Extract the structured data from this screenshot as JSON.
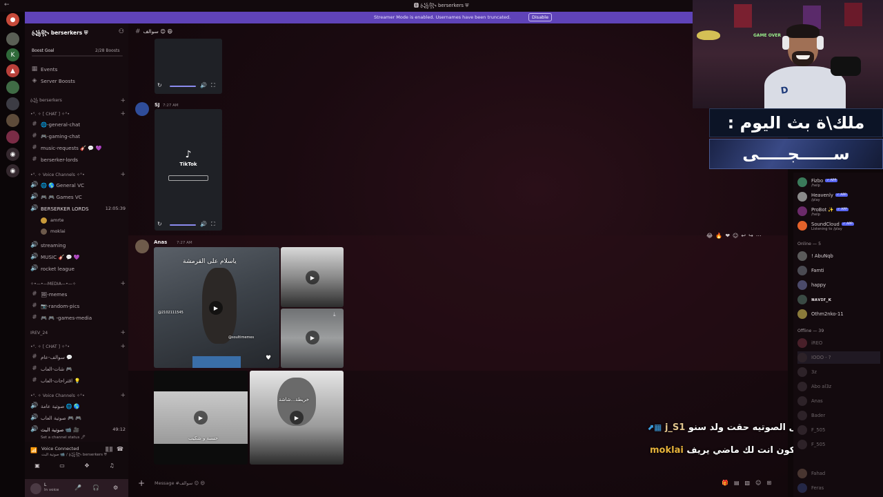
{
  "window": {
    "title": "🅱 ꧁ꦿ꧂ berserkers ⛨",
    "back_glyph": "←"
  },
  "banner": {
    "message": "Streamer Mode is enabled. Usernames have been truncated.",
    "disable_label": "Disable"
  },
  "server": {
    "name": "꧁ꦿ꧂ berserkers ⛨",
    "boost_goal_label": "Boost Goal",
    "boost_count": "2/28 Boosts"
  },
  "sidebar": {
    "top_items": [
      "Events",
      "Server Boosts"
    ],
    "category_berserkers": "꧁ꦿ berserkers",
    "text_channels_1": [
      "🌐-general-chat",
      "🎮-gaming-chat",
      "music-requests 🎸 💬 💜",
      "berserker-lords"
    ],
    "voice_category_1": "•°. ✧ Voice Channels ✧°•",
    "voice_channels_1": [
      "🌐 🌎 General VC",
      "🎮 🎮 Games VC",
      "BERSERKER LORDS"
    ],
    "berserker_lords_time": "12:05:39",
    "voice_users": [
      "amrte",
      "moklai"
    ],
    "voice_channels_2": [
      "streaming",
      "MUSIC 🎸 💬 💜",
      "rocket league"
    ],
    "media_category": "✧•—•—MEDIA—•—✧",
    "media_channels": [
      "🖼-memes",
      "📷-random-pics",
      "🎮 🎮 -games-media"
    ],
    "irev_category": "IREV_24",
    "chat_category_2": "•°. ✧ [ CHAT ] ✧°•",
    "text_channels_2": [
      "سوالف-عام 💬",
      "شات-العاب 🎮",
      "اقتراحات-العاب 💡"
    ],
    "voice_category_2": "•°. ✧ Voice Channels ✧°•",
    "voice_channels_3": [
      "صوتية عامة 🌐 🌎",
      "صوتية العاب 🎮 🎮",
      "صوتية البث 📹 🎥"
    ],
    "stream_vc_time": "49:12"
  },
  "voice_connected": {
    "title": "Voice Connected",
    "subtitle": "صوتية البث 📹 / ꧁ꦿ꧂ berserkers ⛨",
    "status_hint": "Set a channel status 🖊"
  },
  "user": {
    "name": "L",
    "status": "In voice"
  },
  "main": {
    "channel_name": "سوالف 😊 😄",
    "messages": [
      {
        "author": "SJ",
        "time": "7:27 AM",
        "media": "TikTok"
      },
      {
        "author": "Anas",
        "time": "7:27 AM"
      }
    ],
    "media_captions": {
      "video1": "ياسلام على القرمشة",
      "video1_user": "@soultimemes",
      "video1_id": "@2102111545",
      "video4": "حسبة و شكيب",
      "video5": "خريطة...شاشة"
    },
    "composer_placeholder": "Message #سوالف 😊 😄"
  },
  "chat_overlay": [
    {
      "nick": "j_S1",
      "text": "احبال الصوتيه حقت ولد سنو :"
    },
    {
      "nick": "moklai",
      "text": "لا يكون انت لك ماضي يريف :"
    }
  ],
  "members": {
    "apps": [
      {
        "name": "Fizbo",
        "sub": "/help",
        "badge": "✓ APP"
      },
      {
        "name": "Heavenly",
        "sub": "/play",
        "badge": "✓ APP"
      },
      {
        "name": "ProBot ✨",
        "sub": "/help",
        "badge": "✓ APP"
      },
      {
        "name": "SoundCloud",
        "sub": "Listening to /play",
        "badge": "✓ APP"
      }
    ],
    "online_label": "Online — 5",
    "online": [
      "! AbuNqb",
      "Famti",
      "happy",
      "ɴᴀᴠɪғ_ᴋ",
      "Othm2nko-11"
    ],
    "offline_label": "Offline — 39",
    "offline": [
      "iREO",
      "IOOO - ?",
      "3z",
      "Abo al3z",
      "Anas",
      "Bader",
      "F_505",
      "F_505",
      "Fahad",
      "Feras"
    ]
  },
  "stream_card": {
    "top": "ملك\\ة بث اليوم :",
    "bottom": "ســــــجـــــى"
  },
  "webcam": {
    "sign_text": "GAME OVER"
  },
  "colors": {
    "banner": "#5f43b8",
    "sidebar": "#150b0f",
    "accent_app": "#5865f2"
  }
}
